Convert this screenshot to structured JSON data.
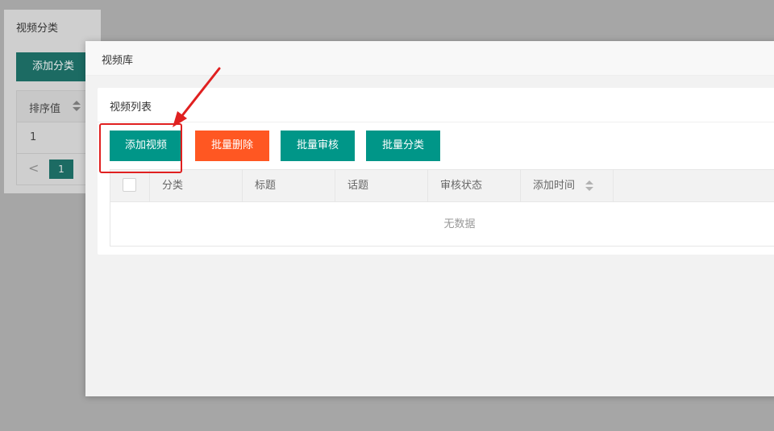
{
  "background": {
    "title": "视频分类",
    "add_button": "添加分类",
    "column_header": "排序值",
    "row_value": "1",
    "pager_prev": "<",
    "pager_page": "1"
  },
  "modal": {
    "title": "视频库",
    "card_title": "视频列表",
    "buttons": {
      "add": "添加视频",
      "batch_delete": "批量删除",
      "batch_audit": "批量审核",
      "batch_category": "批量分类"
    },
    "table": {
      "columns": [
        "分类",
        "标题",
        "话题",
        "审核状态",
        "添加时间"
      ],
      "empty_text": "无数据"
    }
  },
  "colors": {
    "primary": "#009688",
    "danger": "#ff5722",
    "annotation": "#e02020"
  }
}
